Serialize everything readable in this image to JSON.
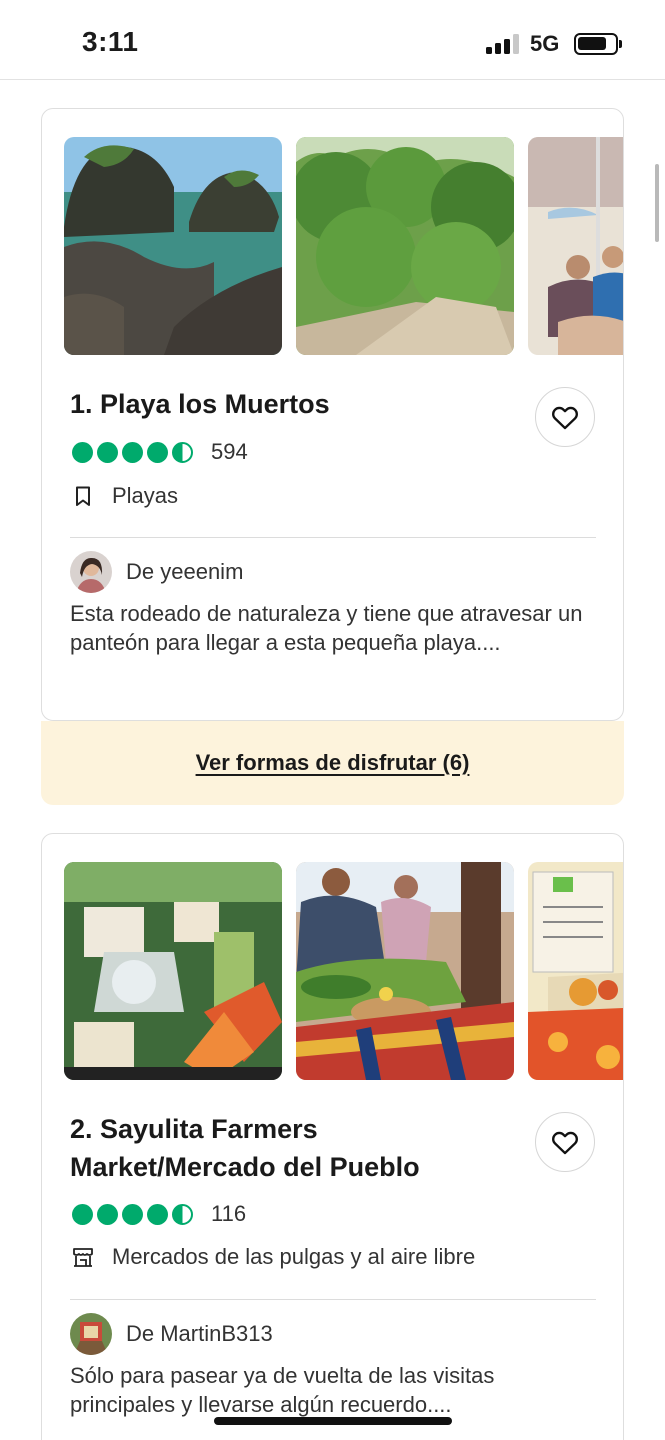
{
  "status_bar": {
    "time": "3:11",
    "network": "5G",
    "battery_level": 0.8
  },
  "listings": [
    {
      "title": "1. Playa los Muertos",
      "rating_bubbles": 4.5,
      "review_count": "594",
      "category": "Playas",
      "category_icon": "bookmark-icon",
      "reviewer": "De yeeenim",
      "snippet": "Esta rodeado de naturaleza y tiene que atravesar un panteón para llegar a esta pequeña playa....",
      "action_label": "Ver formas de disfrutar (6)"
    },
    {
      "title": "2. Sayulita Farmers Market/Mercado del Pueblo",
      "rating_bubbles": 4.5,
      "review_count": "116",
      "category": "Mercados de las pulgas y al aire libre",
      "category_icon": "market-stall-icon",
      "reviewer": "De MartinB313",
      "snippet": "Sólo para pasear ya de vuelta de las visitas principales y llevarse algún recuerdo...."
    }
  ],
  "colors": {
    "rating_green": "#00aa6c",
    "action_background": "#fdf3dc",
    "text_primary": "#1a1a1a"
  }
}
